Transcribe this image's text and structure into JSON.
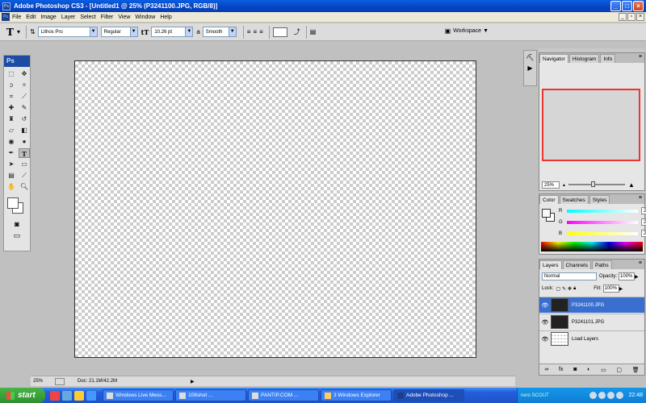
{
  "window": {
    "title": "Adobe Photoshop CS3 - [Untitled1 @ 25% (P3241100.JPG, RGB/8)]",
    "app_icon": "Ps"
  },
  "menu": {
    "items": [
      "File",
      "Edit",
      "Image",
      "Layer",
      "Select",
      "Filter",
      "View",
      "Window",
      "Help"
    ]
  },
  "options": {
    "font_family": "Lithos Pro",
    "font_style": "Regular",
    "font_size": "10.26 pt",
    "aa_icon_label": "a",
    "aa_method": "Smooth",
    "workspace_label": "Workspace"
  },
  "toolbox": {
    "logo": "Ps"
  },
  "status": {
    "zoom": "25%",
    "doc": "Doc: 21.1M/42.2M"
  },
  "navigator": {
    "tabs": [
      "Navigator",
      "Histogram",
      "Info"
    ],
    "zoom": "25%"
  },
  "color": {
    "tabs": [
      "Color",
      "Swatches",
      "Styles"
    ],
    "r_label": "R",
    "g_label": "G",
    "b_label": "B",
    "r": "252",
    "g": "247",
    "b": "247"
  },
  "layers": {
    "tabs": [
      "Layers",
      "Channels",
      "Paths"
    ],
    "blend_mode": "Normal",
    "opacity_label": "Opacity:",
    "opacity": "100%",
    "lock_label": "Lock:",
    "fill_label": "Fill:",
    "fill": "100%",
    "items": [
      {
        "name": "P3241100.JPG",
        "selected": true
      },
      {
        "name": "P3241101.JPG",
        "selected": false
      },
      {
        "name": "Load Layers",
        "selected": false
      }
    ]
  },
  "taskbar": {
    "start": "start",
    "tasks": [
      "Windows Live Mess...",
      "108shot ...",
      "PANTIP.COM ...",
      "3 Windows Explorer",
      "Adobe Photoshop ..."
    ],
    "tray_brand": "nero SCOUT",
    "clock": "22:48"
  },
  "colors": {
    "title_blue": "#0543c4",
    "layer_selected": "#3a6fd0",
    "nav_box": "#ee3333"
  }
}
